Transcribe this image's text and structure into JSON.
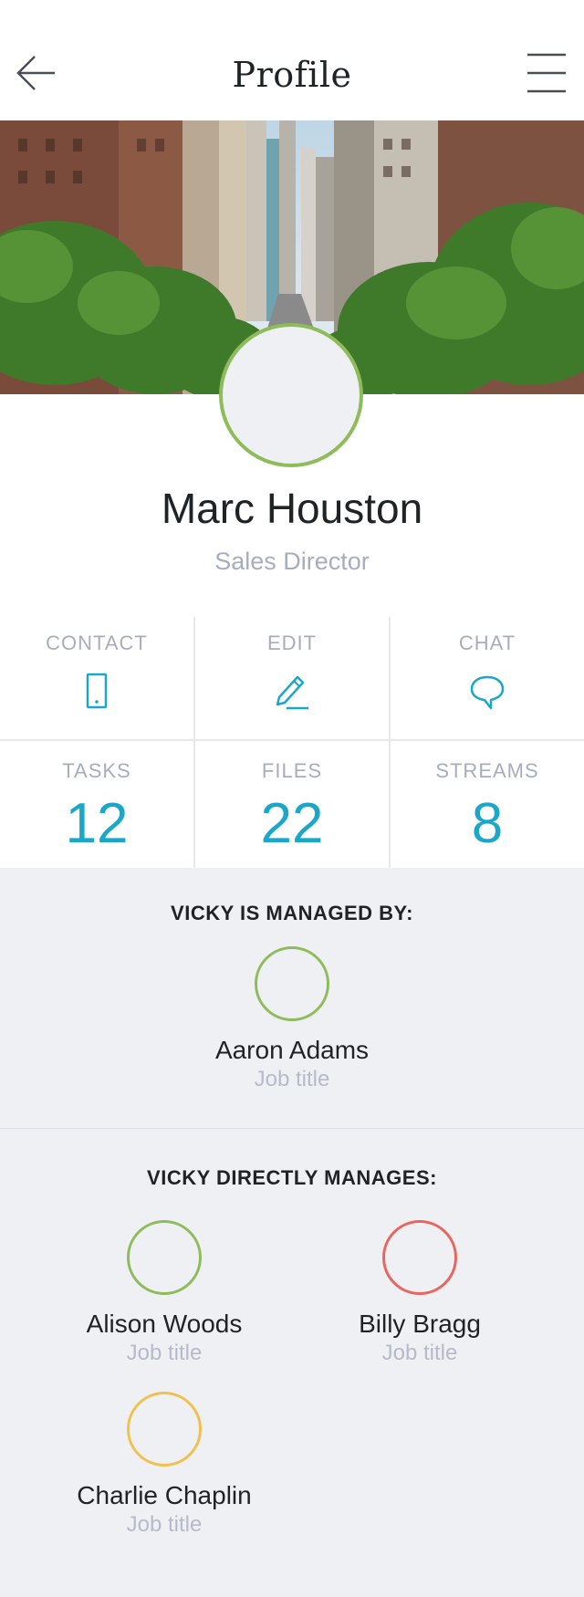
{
  "header": {
    "title": "Profile",
    "back_icon": "arrow-left-icon",
    "menu_icon": "hamburger-menu-icon"
  },
  "profile": {
    "name": "Marc Houston",
    "role": "Sales Director",
    "avatar_border_color": "#8fbc5a"
  },
  "actions": [
    {
      "label": "CONTACT",
      "icon": "phone-icon"
    },
    {
      "label": "EDIT",
      "icon": "pencil-icon"
    },
    {
      "label": "CHAT",
      "icon": "chat-bubble-icon"
    }
  ],
  "stats": [
    {
      "label": "TASKS",
      "value": "12"
    },
    {
      "label": "FILES",
      "value": "22"
    },
    {
      "label": "STREAMS",
      "value": "8"
    }
  ],
  "managed_by": {
    "title": "VICKY IS MANAGED BY:",
    "people": [
      {
        "name": "Aaron Adams",
        "job": "Job title",
        "color": "#8fbc5a"
      }
    ]
  },
  "manages": {
    "title": "VICKY DIRECTLY MANAGES:",
    "people": [
      {
        "name": "Alison Woods",
        "job": "Job title",
        "color": "#8fbc5a"
      },
      {
        "name": "Billy Bragg",
        "job": "Job title",
        "color": "#e8665f"
      },
      {
        "name": "Charlie Chaplin",
        "job": "Job title",
        "color": "#f2c04e"
      }
    ]
  },
  "colors": {
    "accent": "#1aa7c9",
    "muted_text": "#a7adbd",
    "background": "#eff0f4"
  }
}
